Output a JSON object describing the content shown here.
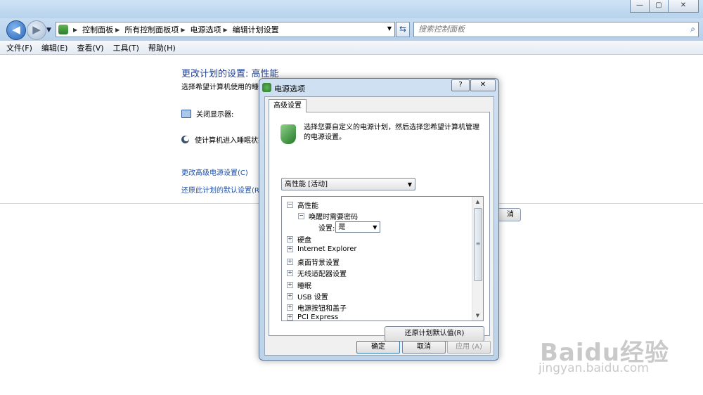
{
  "window": {
    "controls": {
      "minimize": "—",
      "maximize": "▢",
      "close": "✕"
    }
  },
  "nav": {
    "back_icon": "arrow-left-icon",
    "forward_icon": "arrow-right-icon",
    "history_icon": "chevron-down-icon",
    "breadcrumbs": [
      "控制面板",
      "所有控制面板项",
      "电源选项",
      "编辑计划设置"
    ],
    "search_placeholder": "搜索控制面板"
  },
  "menu": [
    "文件(F)",
    "编辑(E)",
    "查看(V)",
    "工具(T)",
    "帮助(H)"
  ],
  "page": {
    "title": "更改计划的设置: 高性能",
    "description": "选择希望计算机使用的睡眠",
    "display_off_label": "关闭显示器:",
    "sleep_label": "使计算机进入睡眠状态",
    "link_advanced": "更改高级电源设置(C)",
    "link_restore": "还原此计划的默认设置(R)",
    "cancel_partial": "消"
  },
  "dialog": {
    "title": "电源选项",
    "help_label": "?",
    "close_label": "✕",
    "tab_label": "高级设置",
    "intro_line1": "选择您要自定义的电源计划，然后选择您希望计算机管理",
    "intro_line2": "的电源设置。",
    "plan_selected": "高性能 [活动]",
    "tree": {
      "root": "高性能",
      "child": "唤醒时需要密码",
      "setting_label": "设置:",
      "setting_value": "是",
      "items": [
        "硬盘",
        "Internet Explorer",
        "桌面背景设置",
        "无线适配器设置",
        "睡眠",
        "USB 设置",
        "电源按钮和盖子",
        "PCI Express"
      ],
      "expand_glyph": "+",
      "collapse_glyph": "−"
    },
    "restore_button": "还原计划默认值(R)",
    "ok_button": "确定",
    "cancel_button": "取消",
    "apply_button": "应用 (A)"
  },
  "watermark": {
    "main": "Baidu经验",
    "sub": "jingyan.baidu.com"
  }
}
